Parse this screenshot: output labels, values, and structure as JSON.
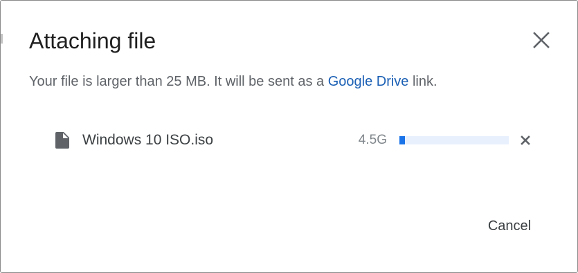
{
  "dialog": {
    "title": "Attaching file",
    "close_icon": "close-icon"
  },
  "message": {
    "before_link": "Your file is larger than 25 MB. It will be sent as a ",
    "link_text": "Google Drive",
    "after_link": " link."
  },
  "file": {
    "icon": "file-icon",
    "name": "Windows 10 ISO.iso",
    "size": "4.5G",
    "progress_percent": 5,
    "remove_icon": "close-icon"
  },
  "actions": {
    "cancel_label": "Cancel"
  },
  "colors": {
    "link": "#1a5fb4",
    "progress_fill": "#1a73e8",
    "progress_track": "#e8f0fe"
  }
}
